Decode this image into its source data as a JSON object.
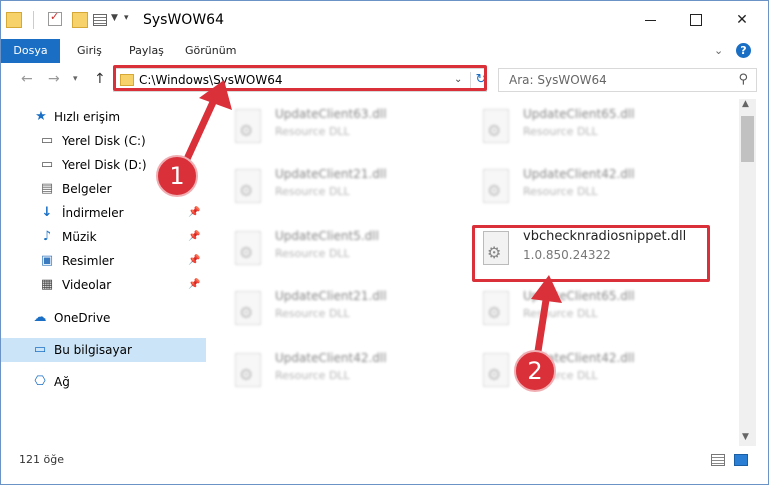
{
  "window": {
    "title": "SysWOW64",
    "controls": {
      "minimize": "minimize-icon",
      "maximize": "maximize-icon",
      "close": "✕"
    }
  },
  "ribbon": {
    "tabs": [
      "Dosya",
      "Giriş",
      "Paylaş",
      "Görünüm"
    ],
    "help": "?"
  },
  "address": {
    "path": "C:\\Windows\\SysWOW64",
    "search_placeholder": "Ara: SysWOW64"
  },
  "sidebar": {
    "items": [
      {
        "label": "Hızlı erişim",
        "icon": "star-icon"
      },
      {
        "label": "Yerel Disk (C:)",
        "icon": "drive-icon"
      },
      {
        "label": "Yerel Disk (D:)",
        "icon": "drive-icon"
      },
      {
        "label": "Belgeler",
        "icon": "document-icon"
      },
      {
        "label": "İndirmeler",
        "icon": "download-icon"
      },
      {
        "label": "Müzik",
        "icon": "music-icon"
      },
      {
        "label": "Resimler",
        "icon": "pictures-icon"
      },
      {
        "label": "Videolar",
        "icon": "video-icon"
      },
      {
        "label": "OneDrive",
        "icon": "cloud-icon"
      },
      {
        "label": "Bu bilgisayar",
        "icon": "computer-icon"
      },
      {
        "label": "Ağ",
        "icon": "network-icon"
      }
    ]
  },
  "files": [
    {
      "name": "UpdateClient63.dll",
      "type": "Resource DLL"
    },
    {
      "name": "UpdateClient65.dll",
      "type": "Resource DLL"
    },
    {
      "name": "UpdateClient21.dll",
      "type": "Resource DLL"
    },
    {
      "name": "UpdateClient42.dll",
      "type": "Resource DLL"
    },
    {
      "name": "UpdateClient5.dll",
      "type": "Resource DLL"
    },
    {
      "name": "vbchecknradiosnippet.dll",
      "type": "1.0.850.24322"
    },
    {
      "name": "UpdateClient21.dll",
      "type": "Resource DLL"
    },
    {
      "name": "UpdateClient65.dll",
      "type": "Resource DLL"
    },
    {
      "name": "UpdateClient42.dll",
      "type": "Resource DLL"
    },
    {
      "name": "UpdateClient42.dll",
      "type": "Resource DLL"
    }
  ],
  "status": {
    "count": "121 öğe"
  },
  "annotations": {
    "step1": "1",
    "step2": "2",
    "color": "#d9303a"
  }
}
